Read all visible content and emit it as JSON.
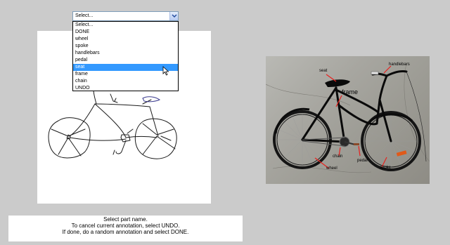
{
  "part_select": {
    "selected_value": "Select...",
    "options": [
      "Select...",
      "DONE",
      "wheel",
      "spoke",
      "handlebars",
      "pedal",
      "seat",
      "frame",
      "chain",
      "UNDO"
    ],
    "highlighted_option": "seat"
  },
  "instructions": {
    "line1": "Select part name.",
    "line2": "To cancel current annotation, select UNDO.",
    "line3": "If done, do a random annotation and select DONE."
  },
  "example_labels": {
    "seat": "seat",
    "handlebars": "handlebars",
    "frame": "frame",
    "chain": "chain",
    "pedal": "pedal",
    "wheel": "wheel",
    "spoke": "spoke"
  },
  "colors": {
    "page_bg": "#cbcbcb",
    "highlight": "#3399ff",
    "label_line": "#e8201e",
    "stroke": "#000000"
  }
}
